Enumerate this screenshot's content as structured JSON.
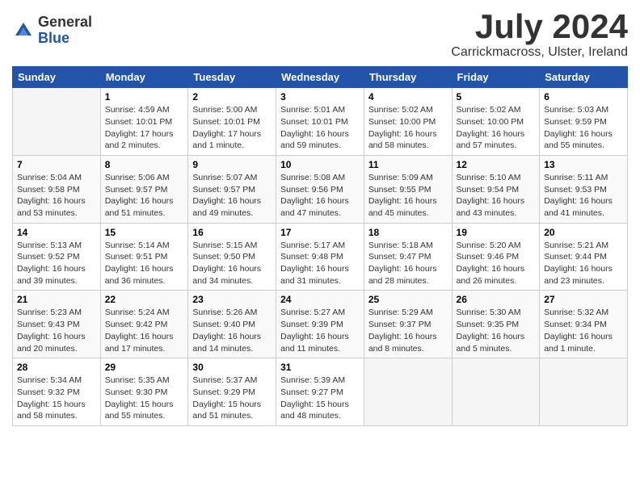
{
  "logo": {
    "general": "General",
    "blue": "Blue"
  },
  "title": "July 2024",
  "subtitle": "Carrickmacross, Ulster, Ireland",
  "days_header": [
    "Sunday",
    "Monday",
    "Tuesday",
    "Wednesday",
    "Thursday",
    "Friday",
    "Saturday"
  ],
  "weeks": [
    [
      {
        "day": "",
        "info": ""
      },
      {
        "day": "1",
        "info": "Sunrise: 4:59 AM\nSunset: 10:01 PM\nDaylight: 17 hours\nand 2 minutes."
      },
      {
        "day": "2",
        "info": "Sunrise: 5:00 AM\nSunset: 10:01 PM\nDaylight: 17 hours\nand 1 minute."
      },
      {
        "day": "3",
        "info": "Sunrise: 5:01 AM\nSunset: 10:01 PM\nDaylight: 16 hours\nand 59 minutes."
      },
      {
        "day": "4",
        "info": "Sunrise: 5:02 AM\nSunset: 10:00 PM\nDaylight: 16 hours\nand 58 minutes."
      },
      {
        "day": "5",
        "info": "Sunrise: 5:02 AM\nSunset: 10:00 PM\nDaylight: 16 hours\nand 57 minutes."
      },
      {
        "day": "6",
        "info": "Sunrise: 5:03 AM\nSunset: 9:59 PM\nDaylight: 16 hours\nand 55 minutes."
      }
    ],
    [
      {
        "day": "7",
        "info": "Sunrise: 5:04 AM\nSunset: 9:58 PM\nDaylight: 16 hours\nand 53 minutes."
      },
      {
        "day": "8",
        "info": "Sunrise: 5:06 AM\nSunset: 9:57 PM\nDaylight: 16 hours\nand 51 minutes."
      },
      {
        "day": "9",
        "info": "Sunrise: 5:07 AM\nSunset: 9:57 PM\nDaylight: 16 hours\nand 49 minutes."
      },
      {
        "day": "10",
        "info": "Sunrise: 5:08 AM\nSunset: 9:56 PM\nDaylight: 16 hours\nand 47 minutes."
      },
      {
        "day": "11",
        "info": "Sunrise: 5:09 AM\nSunset: 9:55 PM\nDaylight: 16 hours\nand 45 minutes."
      },
      {
        "day": "12",
        "info": "Sunrise: 5:10 AM\nSunset: 9:54 PM\nDaylight: 16 hours\nand 43 minutes."
      },
      {
        "day": "13",
        "info": "Sunrise: 5:11 AM\nSunset: 9:53 PM\nDaylight: 16 hours\nand 41 minutes."
      }
    ],
    [
      {
        "day": "14",
        "info": "Sunrise: 5:13 AM\nSunset: 9:52 PM\nDaylight: 16 hours\nand 39 minutes."
      },
      {
        "day": "15",
        "info": "Sunrise: 5:14 AM\nSunset: 9:51 PM\nDaylight: 16 hours\nand 36 minutes."
      },
      {
        "day": "16",
        "info": "Sunrise: 5:15 AM\nSunset: 9:50 PM\nDaylight: 16 hours\nand 34 minutes."
      },
      {
        "day": "17",
        "info": "Sunrise: 5:17 AM\nSunset: 9:48 PM\nDaylight: 16 hours\nand 31 minutes."
      },
      {
        "day": "18",
        "info": "Sunrise: 5:18 AM\nSunset: 9:47 PM\nDaylight: 16 hours\nand 28 minutes."
      },
      {
        "day": "19",
        "info": "Sunrise: 5:20 AM\nSunset: 9:46 PM\nDaylight: 16 hours\nand 26 minutes."
      },
      {
        "day": "20",
        "info": "Sunrise: 5:21 AM\nSunset: 9:44 PM\nDaylight: 16 hours\nand 23 minutes."
      }
    ],
    [
      {
        "day": "21",
        "info": "Sunrise: 5:23 AM\nSunset: 9:43 PM\nDaylight: 16 hours\nand 20 minutes."
      },
      {
        "day": "22",
        "info": "Sunrise: 5:24 AM\nSunset: 9:42 PM\nDaylight: 16 hours\nand 17 minutes."
      },
      {
        "day": "23",
        "info": "Sunrise: 5:26 AM\nSunset: 9:40 PM\nDaylight: 16 hours\nand 14 minutes."
      },
      {
        "day": "24",
        "info": "Sunrise: 5:27 AM\nSunset: 9:39 PM\nDaylight: 16 hours\nand 11 minutes."
      },
      {
        "day": "25",
        "info": "Sunrise: 5:29 AM\nSunset: 9:37 PM\nDaylight: 16 hours\nand 8 minutes."
      },
      {
        "day": "26",
        "info": "Sunrise: 5:30 AM\nSunset: 9:35 PM\nDaylight: 16 hours\nand 5 minutes."
      },
      {
        "day": "27",
        "info": "Sunrise: 5:32 AM\nSunset: 9:34 PM\nDaylight: 16 hours\nand 1 minute."
      }
    ],
    [
      {
        "day": "28",
        "info": "Sunrise: 5:34 AM\nSunset: 9:32 PM\nDaylight: 15 hours\nand 58 minutes."
      },
      {
        "day": "29",
        "info": "Sunrise: 5:35 AM\nSunset: 9:30 PM\nDaylight: 15 hours\nand 55 minutes."
      },
      {
        "day": "30",
        "info": "Sunrise: 5:37 AM\nSunset: 9:29 PM\nDaylight: 15 hours\nand 51 minutes."
      },
      {
        "day": "31",
        "info": "Sunrise: 5:39 AM\nSunset: 9:27 PM\nDaylight: 15 hours\nand 48 minutes."
      },
      {
        "day": "",
        "info": ""
      },
      {
        "day": "",
        "info": ""
      },
      {
        "day": "",
        "info": ""
      }
    ]
  ]
}
